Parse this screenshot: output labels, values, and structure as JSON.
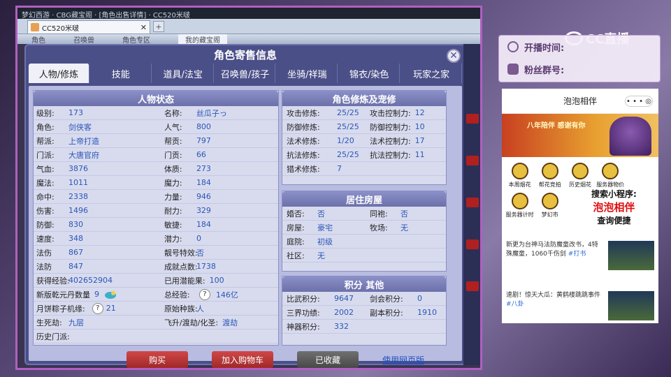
{
  "app": {
    "titlebar": "梦幻西游 · CBG藏宝阁 · [角色出售详情] · CC520米啵",
    "browser_tab": "CC520米啵",
    "page_strip": [
      "角色",
      "召唤兽",
      "角色专区",
      "我的藏宝阁"
    ]
  },
  "dialog": {
    "title": "角色寄售信息",
    "tabs": [
      "人物/修炼",
      "技能",
      "道具/法宝",
      "召唤兽/孩子",
      "坐骑/祥瑞",
      "锦衣/染色",
      "玩家之家"
    ]
  },
  "character": {
    "header": "人物状态",
    "rows": [
      [
        {
          "label": "级别:",
          "value": "173"
        },
        {
          "label": "名称:",
          "value": "丝瓜子っ"
        }
      ],
      [
        {
          "label": "角色:",
          "value": "剑侠客"
        },
        {
          "label": "人气:",
          "value": "800"
        }
      ],
      [
        {
          "label": "帮派:",
          "value": "上帝打造"
        },
        {
          "label": "帮贡:",
          "value": "797"
        }
      ],
      [
        {
          "label": "门派:",
          "value": "大唐官府"
        },
        {
          "label": "门贡:",
          "value": "66"
        }
      ],
      [
        {
          "label": "气血:",
          "value": "3876"
        },
        {
          "label": "体质:",
          "value": "273"
        }
      ],
      [
        {
          "label": "魔法:",
          "value": "1011"
        },
        {
          "label": "魔力:",
          "value": "184"
        }
      ],
      [
        {
          "label": "命中:",
          "value": "2338"
        },
        {
          "label": "力量:",
          "value": "946"
        }
      ],
      [
        {
          "label": "伤害:",
          "value": "1496"
        },
        {
          "label": "耐力:",
          "value": "329"
        }
      ],
      [
        {
          "label": "防御:",
          "value": "830"
        },
        {
          "label": "敏捷:",
          "value": "184"
        }
      ],
      [
        {
          "label": "速度:",
          "value": "348"
        },
        {
          "label": "潜力:",
          "value": "0"
        }
      ],
      [
        {
          "label": "法伤",
          "value": "867"
        },
        {
          "label": "靓号特效:",
          "value": "否"
        }
      ],
      [
        {
          "label": "法防",
          "value": "847"
        },
        {
          "label": "成就点数:",
          "value": "1738"
        }
      ],
      [
        {
          "label": "获得经验:",
          "value": "402652904"
        },
        {
          "label": "已用潜能果:",
          "value": "100"
        }
      ],
      [
        {
          "label": "新版乾元丹数量",
          "value": "9"
        },
        {
          "label": "总经验:",
          "value": "146亿"
        }
      ],
      [
        {
          "label": "月饼粽子机缘:",
          "value": "21"
        },
        {
          "label": "原始种族:",
          "value": "人"
        }
      ],
      [
        {
          "label": "生死劫:",
          "value": "九层"
        },
        {
          "label": "飞升/渡劫/化圣:",
          "value": "渡劫"
        }
      ],
      [
        {
          "label": "历史门派:",
          "value": ""
        },
        {
          "label": "",
          "value": ""
        }
      ]
    ]
  },
  "cultivation": {
    "header": "角色修炼及宠修",
    "rows": [
      [
        {
          "label": "攻击修炼:",
          "value": "25/25"
        },
        {
          "label": "攻击控制力:",
          "value": "12"
        }
      ],
      [
        {
          "label": "防御修炼:",
          "value": "25/25"
        },
        {
          "label": "防御控制力:",
          "value": "10"
        }
      ],
      [
        {
          "label": "法术修炼:",
          "value": "1/20"
        },
        {
          "label": "法术控制力:",
          "value": "17"
        }
      ],
      [
        {
          "label": "抗法修炼:",
          "value": "25/25"
        },
        {
          "label": "抗法控制力:",
          "value": "11"
        }
      ],
      [
        {
          "label": "猎术修炼:",
          "value": "7"
        },
        {
          "label": "",
          "value": ""
        }
      ]
    ]
  },
  "house": {
    "header": "居住房屋",
    "rows": [
      [
        {
          "label": "婚否:",
          "value": "否"
        },
        {
          "label": "同袍:",
          "value": "否"
        }
      ],
      [
        {
          "label": "房屋:",
          "value": "豪宅"
        },
        {
          "label": "牧场:",
          "value": "无"
        }
      ],
      [
        {
          "label": "庭院:",
          "value": "初级"
        },
        {
          "label": "",
          "value": ""
        }
      ],
      [
        {
          "label": "社区:",
          "value": "无"
        },
        {
          "label": "",
          "value": ""
        }
      ]
    ]
  },
  "points": {
    "header": "积分 其他",
    "rows": [
      [
        {
          "label": "比武积分:",
          "value": "9647"
        },
        {
          "label": "剑会积分:",
          "value": "0"
        }
      ],
      [
        {
          "label": "三界功绩:",
          "value": "2002"
        },
        {
          "label": "副本积分:",
          "value": "1910"
        }
      ],
      [
        {
          "label": "神器积分:",
          "value": "332"
        },
        {
          "label": "",
          "value": ""
        }
      ]
    ]
  },
  "actions": {
    "buy": "购买",
    "add_cart": "加入购物车",
    "favorited": "已收藏",
    "web_version": "使用网页版"
  },
  "overlay": {
    "logo": "CC直播",
    "open_time": "开播时间:",
    "fans_group": "粉丝群号:",
    "mini_app_title": "泡泡相伴",
    "mini_app_menu": "• • •  ◎",
    "banner_text": "八年陪伴 感谢有你",
    "grid": [
      "本周烟花",
      "帮花竞拍",
      "历史烟花",
      "服务器物价",
      "",
      "服务器计时",
      "梦幻市",
      "",
      "",
      ""
    ],
    "promo_line1": "搜索小程序:",
    "promo_line2": "泡泡相伴",
    "promo_line3": "查询便捷",
    "news": [
      {
        "text": "新更为台神马法防魔童改书，4特殊魔童，1060千伤剑",
        "tag": "#打书"
      },
      {
        "text": "速剧！惊天大瓜：黄鹤楼跳跳事件",
        "tag": "#八卦"
      }
    ]
  }
}
